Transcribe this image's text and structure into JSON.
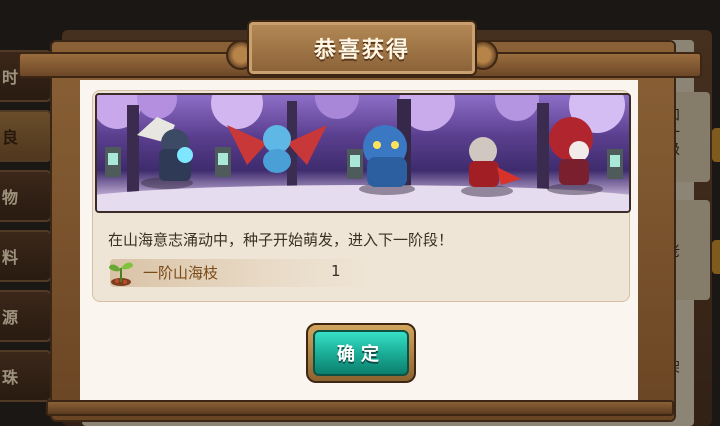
{
  "dialog": {
    "title": "恭喜获得",
    "message": "在山海意志涌动中，种子开始萌发，进入下一阶段！",
    "reward": {
      "icon": "sprout-icon",
      "name": "一阶山海枝",
      "count": "1"
    },
    "confirm_label": "确定"
  },
  "background": {
    "side_tabs": [
      "时",
      "良",
      "物",
      "料",
      "源",
      "珠"
    ],
    "active_tab_index": 1,
    "right_texts": [
      "身和\n虫一\n升级",
      "山老",
      "理架\n里"
    ]
  },
  "colors": {
    "accent": "#1cae98",
    "frame": "#8a6136",
    "title_text": "#fff6e4",
    "reward_name": "#7a4a17"
  }
}
